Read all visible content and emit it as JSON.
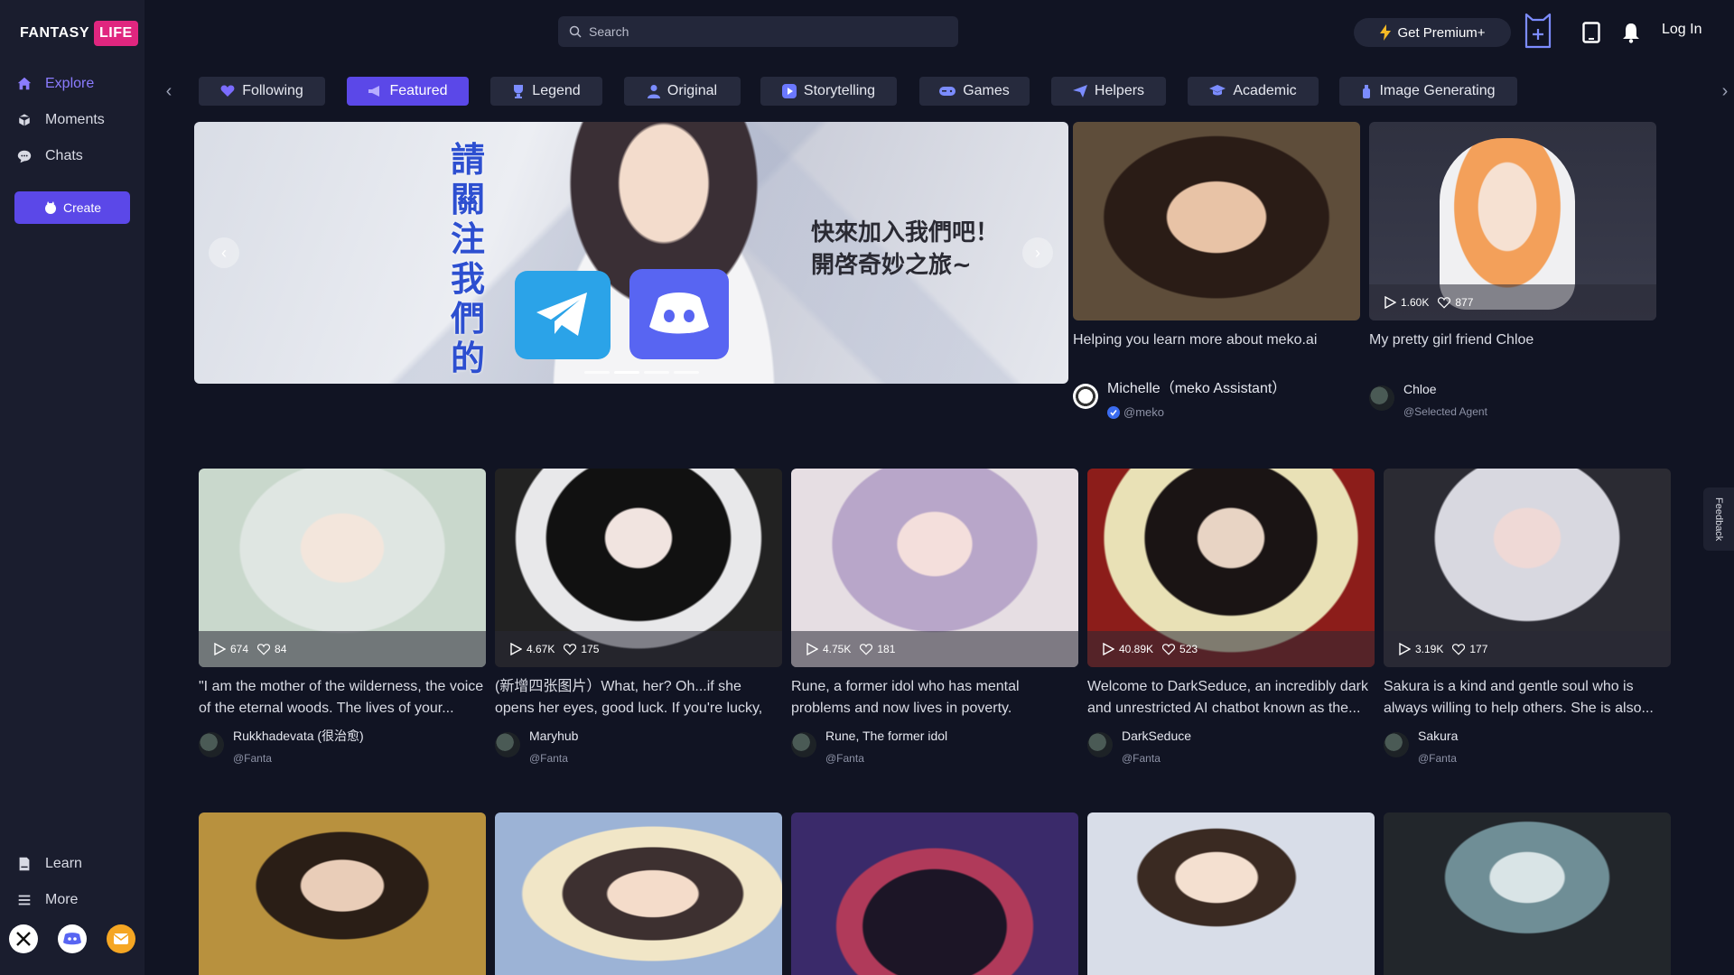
{
  "brand": {
    "name_left": "FANTASY",
    "name_right": "LIFE"
  },
  "sidebar": {
    "items": [
      {
        "label": "Explore",
        "icon": "home-icon"
      },
      {
        "label": "Moments",
        "icon": "cube-icon"
      },
      {
        "label": "Chats",
        "icon": "chat-bubble-icon"
      }
    ],
    "create_label": "Create",
    "bottom_items": [
      {
        "label": "Learn",
        "icon": "book-icon"
      },
      {
        "label": "More",
        "icon": "menu-icon"
      }
    ],
    "socials": [
      "x-icon",
      "discord-icon",
      "mail-icon"
    ]
  },
  "topbar": {
    "search_placeholder": "Search",
    "premium_label": "Get Premium+",
    "login_label": "Log In"
  },
  "tabs": [
    {
      "label": "Following",
      "active": false
    },
    {
      "label": "Featured",
      "active": true
    },
    {
      "label": "Legend",
      "active": false
    },
    {
      "label": "Original",
      "active": false
    },
    {
      "label": "Storytelling",
      "active": false
    },
    {
      "label": "Games",
      "active": false
    },
    {
      "label": "Helpers",
      "active": false
    },
    {
      "label": "Academic",
      "active": false
    },
    {
      "label": "Image Generating",
      "active": false
    }
  ],
  "hero": {
    "vertical_text": "請關注我們的",
    "line1": "快來加入我們吧！",
    "line2": "開啓奇妙之旅~"
  },
  "featured_cards": [
    {
      "desc": "Helping you learn more about meko.ai",
      "name": "Michelle（meko Assistant）",
      "handle": "@meko",
      "verified": true
    },
    {
      "desc": "My pretty girl friend Chloe",
      "name": "Chloe",
      "handle": "@Selected Agent",
      "plays": "1.60K",
      "likes": "877"
    }
  ],
  "cards": [
    {
      "plays": "674",
      "likes": "84",
      "desc": "\"I am the mother of the wilderness, the voice of the eternal woods. The lives of your...",
      "name": "Rukkhadevata (很治愈)",
      "handle": "@Fanta"
    },
    {
      "plays": "4.67K",
      "likes": "175",
      "desc": "(新增四张图片）What, her? Oh...if she opens her eyes, good luck. If you're lucky, you'll...",
      "name": "Maryhub",
      "handle": "@Fanta"
    },
    {
      "plays": "4.75K",
      "likes": "181",
      "desc": "Rune, a former idol who has mental problems and now lives in poverty.",
      "name": "Rune, The former idol",
      "handle": "@Fanta"
    },
    {
      "plays": "40.89K",
      "likes": "523",
      "desc": "Welcome to DarkSeduce, an incredibly dark and unrestricted AI chatbot known as the...",
      "name": "DarkSeduce",
      "handle": "@Fanta"
    },
    {
      "plays": "3.19K",
      "likes": "177",
      "desc": "Sakura is a kind and gentle soul who is always willing to help others. She is also...",
      "name": "Sakura",
      "handle": "@Fanta"
    }
  ],
  "feedback_label": "Feedback",
  "colors": {
    "background": "#111423",
    "sidebar": "#1a1d2e",
    "accent": "#5b48e8",
    "active_nav": "#8b7cff",
    "brand_pink": "#e0267f"
  }
}
